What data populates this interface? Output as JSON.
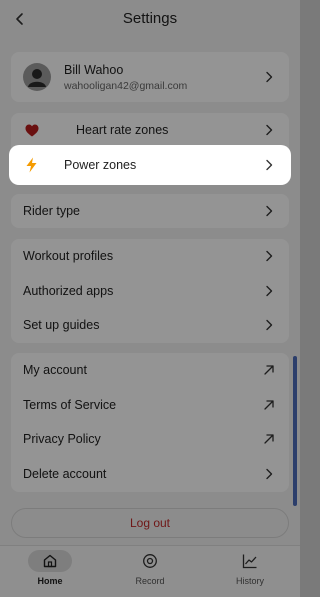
{
  "header": {
    "title": "Settings"
  },
  "profile": {
    "name": "Bill Wahoo",
    "email": "wahooligan42@gmail.com"
  },
  "zones": {
    "heart_rate": "Heart rate zones",
    "power": "Power zones"
  },
  "rider_type": "Rider type",
  "workout": {
    "items": [
      "Workout profiles",
      "Authorized apps",
      "Set up guides"
    ]
  },
  "account": {
    "items": [
      "My account",
      "Terms of Service",
      "Privacy Policy",
      "Delete account"
    ]
  },
  "logout_label": "Log out",
  "tabs": [
    {
      "label": "Home",
      "icon": "home-icon",
      "active": true
    },
    {
      "label": "Record",
      "icon": "record-icon",
      "active": false
    },
    {
      "label": "History",
      "icon": "history-icon",
      "active": false
    }
  ],
  "colors": {
    "heart": "#c62828",
    "power": "#f59b00",
    "logout": "#c02a2a",
    "scrollbar": "#2c3e6b"
  }
}
